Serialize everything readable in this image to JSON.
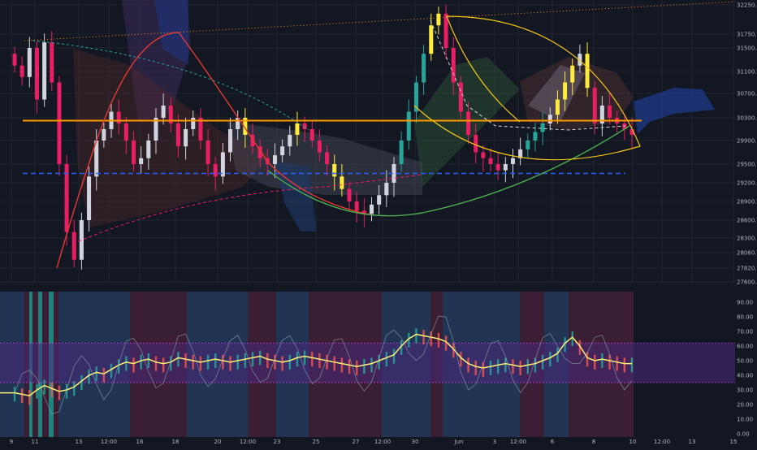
{
  "theme": {
    "background": "#131722",
    "grid": "#1f2430",
    "axis_text": "#b2b5be",
    "candle_up": "#d1d4dc",
    "candle_down": "#e91e63",
    "candle_highlight": "#ffeb3b",
    "candle_teal": "#26a69a",
    "orange_level": "#ff9800",
    "blue_level": "#2962ff",
    "curve_yellow": "#f5c518",
    "curve_red": "#e53935",
    "curve_green": "#4caf50",
    "osc_line": "#fff176"
  },
  "chart_data": [
    {
      "type": "candlestick",
      "name": "price",
      "yticks": [
        32250,
        31750,
        31500,
        31100,
        30700,
        30300,
        29900,
        29500,
        29200,
        28900,
        28600,
        28300,
        28060,
        27820,
        27600
      ],
      "ylim": [
        27600,
        32250
      ],
      "xticks": [
        "9",
        "11",
        "13",
        "12:00",
        "16",
        "18",
        "20",
        "12:00",
        "23",
        "25",
        "27",
        "12:00",
        "30",
        "Jun",
        "3",
        "12:00",
        "6",
        "8",
        "10",
        "12:00",
        "13",
        "15"
      ],
      "levels": [
        {
          "name": "resistance",
          "value": 30250,
          "style": "solid",
          "color": "#ff9800"
        },
        {
          "name": "support",
          "value": 29350,
          "style": "dashed",
          "color": "#2962ff"
        }
      ],
      "close_series": [
        31200,
        31000,
        31500,
        30600,
        31600,
        30900,
        29500,
        28400,
        27950,
        28600,
        29300,
        29900,
        30100,
        30400,
        30200,
        29900,
        29500,
        29600,
        29900,
        30300,
        30500,
        30200,
        29800,
        30100,
        30300,
        29900,
        29500,
        29300,
        29700,
        30100,
        30300,
        30000,
        29800,
        29600,
        29500,
        29650,
        29800,
        30000,
        30200,
        30100,
        29900,
        29700,
        29500,
        29300,
        29100,
        28900,
        28750,
        28700,
        28850,
        29000,
        29200,
        29500,
        29900,
        30400,
        30900,
        31400,
        31900,
        32100,
        31500,
        30900,
        30400,
        30000,
        29700,
        29600,
        29500,
        29400,
        29500,
        29600,
        29750,
        29900,
        30050,
        30200,
        30350,
        30600,
        30900,
        31200,
        31400,
        30800,
        30200,
        30500,
        30300,
        30200,
        30100,
        30000
      ]
    },
    {
      "type": "oscillator",
      "name": "oscillator",
      "yticks": [
        90,
        80,
        70,
        60,
        50,
        40,
        30,
        20,
        10,
        0
      ],
      "ylim": [
        0,
        95
      ],
      "bands": [
        62,
        35
      ],
      "values": [
        28,
        27,
        26,
        30,
        33,
        31,
        29,
        30,
        32,
        36,
        40,
        42,
        41,
        44,
        47,
        49,
        48,
        50,
        51,
        49,
        48,
        49,
        52,
        51,
        50,
        49,
        50,
        51,
        50,
        49,
        50,
        51,
        52,
        53,
        51,
        50,
        49,
        50,
        52,
        53,
        52,
        51,
        50,
        49,
        48,
        47,
        46,
        47,
        48,
        50,
        52,
        54,
        60,
        65,
        68,
        67,
        66,
        65,
        63,
        58,
        52,
        48,
        46,
        45,
        46,
        47,
        48,
        47,
        46,
        47,
        48,
        50,
        52,
        55,
        62,
        66,
        60,
        52,
        50,
        51,
        50,
        49,
        48,
        48
      ]
    }
  ]
}
